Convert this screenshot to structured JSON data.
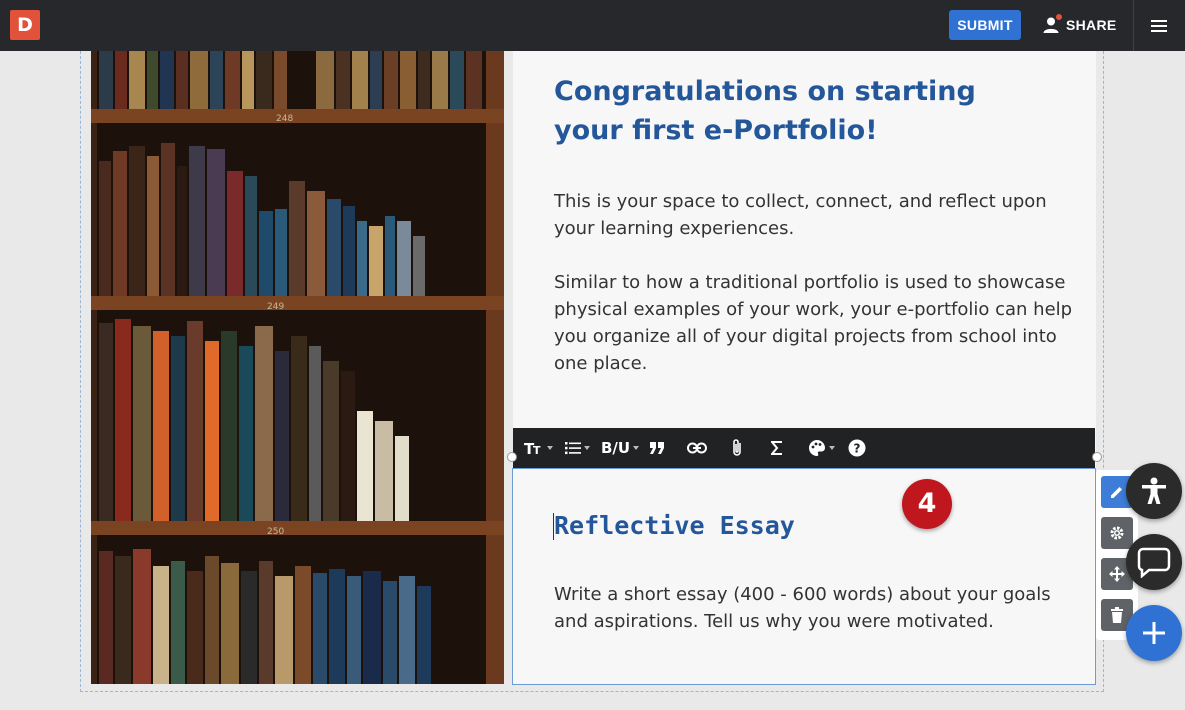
{
  "header": {
    "logo_letter": "D",
    "submit_label": "SUBMIT",
    "share_label": "SHARE"
  },
  "intro": {
    "heading": "Congratulations on starting your first e-Portfolio!",
    "paragraph1": "This is your space to collect, connect, and reflect upon your learning experiences.",
    "paragraph2": "Similar to how a traditional portfolio is used to showcase physical examples of your work, your e-portfolio can help you organize all of your digital projects from school into one place."
  },
  "photo": {
    "shelf_labels": [
      "248",
      "249",
      "250"
    ]
  },
  "toolbar": {
    "items": [
      "text-size",
      "list",
      "bold-underline",
      "quote",
      "link",
      "attachment",
      "equation",
      "color",
      "help"
    ],
    "bold_underline_label": "B/U"
  },
  "essay": {
    "title": "Reflective Essay",
    "body": "Write a short essay (400 - 600 words) about your goals and aspirations. Tell us why you were motivated."
  },
  "step_badge": "4",
  "colors": {
    "topbar": "#26282b",
    "accent": "#2f72d4",
    "heading": "#24579a",
    "badge": "#c0161e",
    "logo": "#e0533a"
  }
}
